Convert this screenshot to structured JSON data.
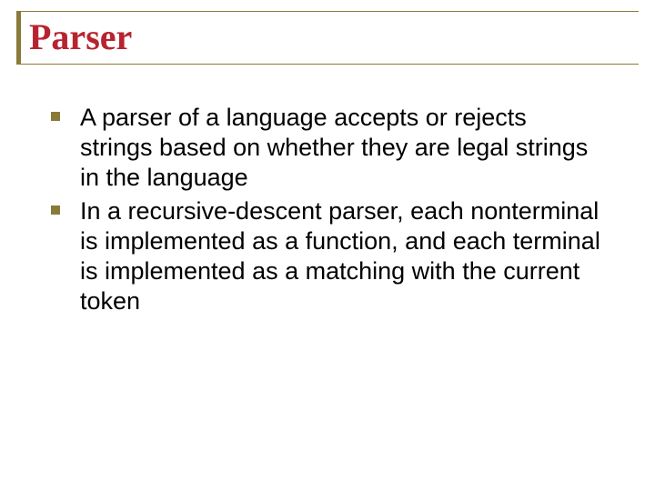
{
  "title": "Parser",
  "bullets": [
    "A parser of a language accepts or rejects strings based on whether they are legal strings in the language",
    "In a recursive-descent parser, each nonterminal is implemented as a function, and each terminal is implemented as a matching with the current token"
  ]
}
